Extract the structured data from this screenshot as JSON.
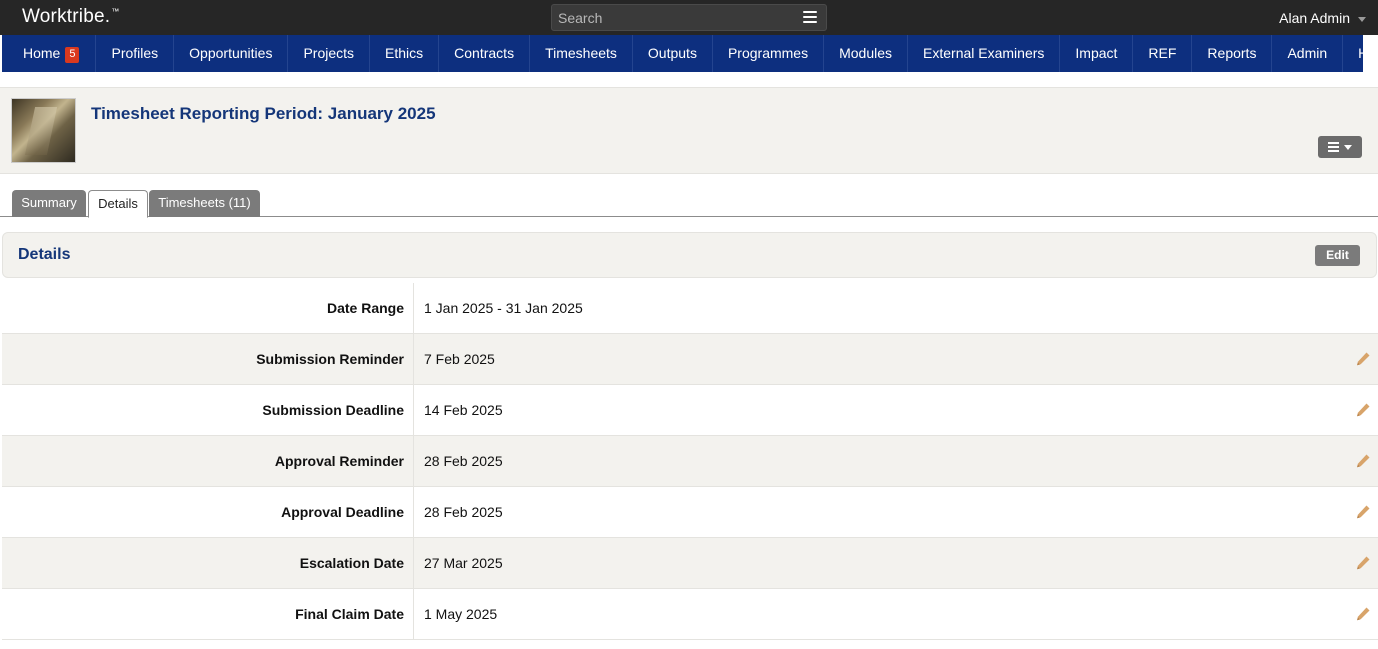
{
  "app": {
    "logo": "Worktribe.",
    "logo_tm": "™",
    "user_name": "Alan Admin"
  },
  "search": {
    "placeholder": "Search"
  },
  "nav": {
    "items": [
      {
        "label": "Home",
        "badge": "5"
      },
      {
        "label": "Profiles"
      },
      {
        "label": "Opportunities"
      },
      {
        "label": "Projects"
      },
      {
        "label": "Ethics"
      },
      {
        "label": "Contracts"
      },
      {
        "label": "Timesheets"
      },
      {
        "label": "Outputs"
      },
      {
        "label": "Programmes"
      },
      {
        "label": "Modules"
      },
      {
        "label": "External Examiners"
      },
      {
        "label": "Impact"
      },
      {
        "label": "REF"
      },
      {
        "label": "Reports"
      },
      {
        "label": "Admin"
      },
      {
        "label": "Help"
      }
    ]
  },
  "header": {
    "title": "Timesheet Reporting Period: January 2025"
  },
  "tabs": [
    {
      "label": "Summary",
      "active": false
    },
    {
      "label": "Details",
      "active": true
    },
    {
      "label": "Timesheets (11)",
      "active": false
    }
  ],
  "details": {
    "title": "Details",
    "edit_label": "Edit",
    "rows": [
      {
        "label": "Date Range",
        "value": "1 Jan 2025 - 31 Jan 2025",
        "editable": false
      },
      {
        "label": "Submission Reminder",
        "value": "7 Feb 2025",
        "editable": true
      },
      {
        "label": "Submission Deadline",
        "value": "14 Feb 2025",
        "editable": true
      },
      {
        "label": "Approval Reminder",
        "value": "28 Feb 2025",
        "editable": true
      },
      {
        "label": "Approval Deadline",
        "value": "28 Feb 2025",
        "editable": true
      },
      {
        "label": "Escalation Date",
        "value": "27 Mar 2025",
        "editable": true
      },
      {
        "label": "Final Claim Date",
        "value": "1 May 2025",
        "editable": true
      }
    ]
  },
  "colors": {
    "topbar": "#262626",
    "nav": "#0d2f7f",
    "title": "#143679",
    "badge": "#d9391f",
    "pencil": "#d8a46a"
  }
}
